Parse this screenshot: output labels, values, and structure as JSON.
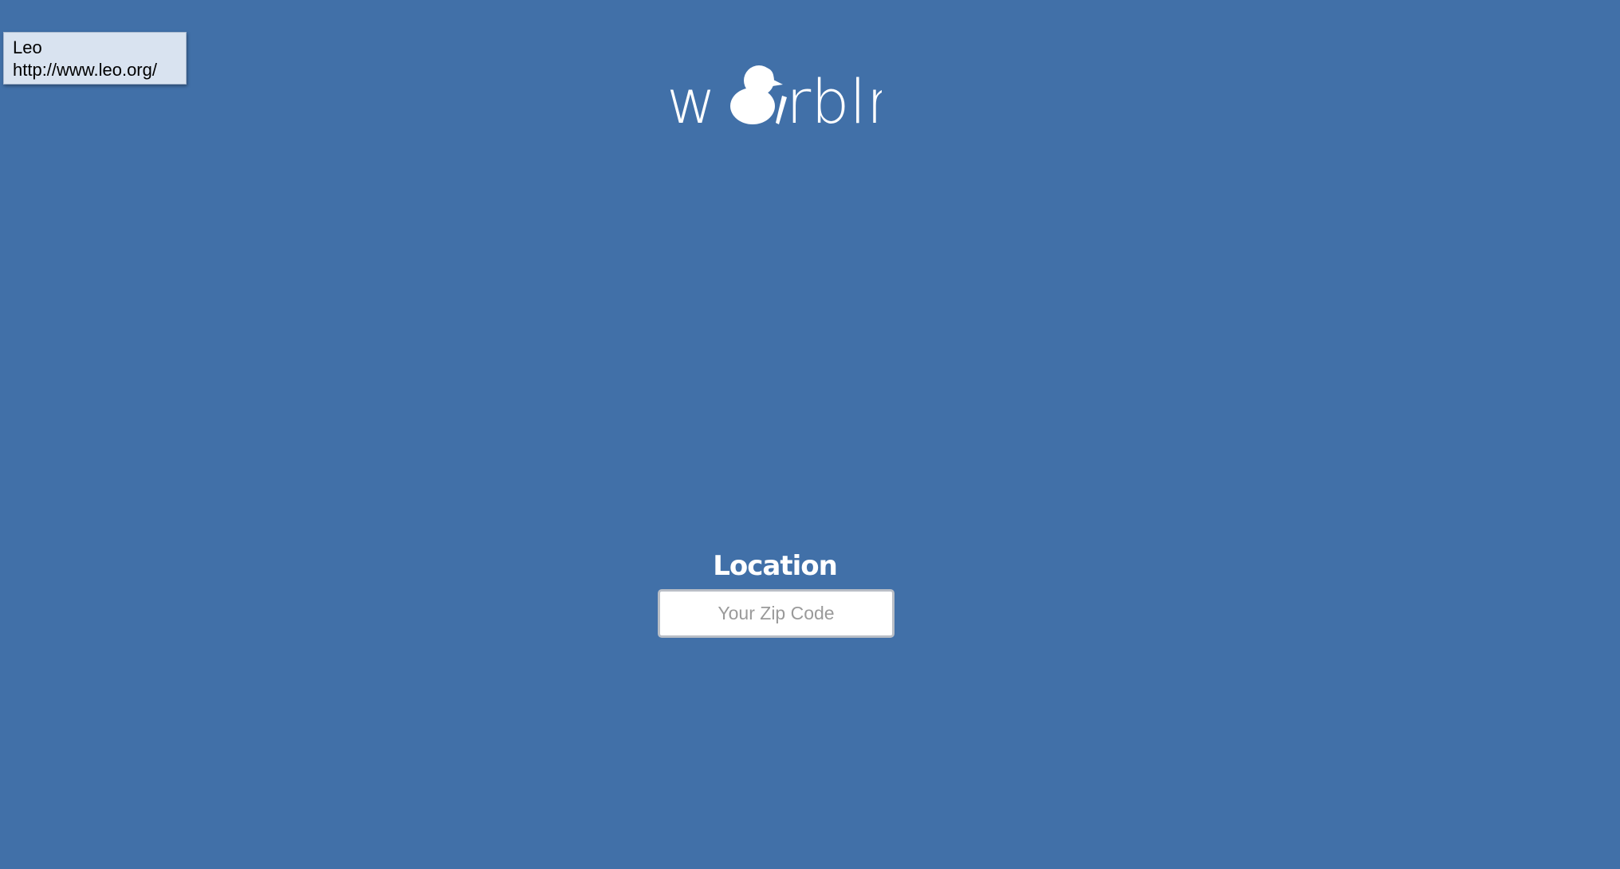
{
  "tooltip": {
    "title": "Leo",
    "url": "http://www.leo.org/"
  },
  "logo": {
    "prefix": "w",
    "suffix": "rblr",
    "icon": "bird-icon"
  },
  "location": {
    "label": "Location",
    "zip_placeholder": "Your Zip Code",
    "zip_value": ""
  },
  "colors": {
    "background": "#4170a8",
    "text": "#ffffff",
    "tooltip_background": "#d9e3f0"
  }
}
